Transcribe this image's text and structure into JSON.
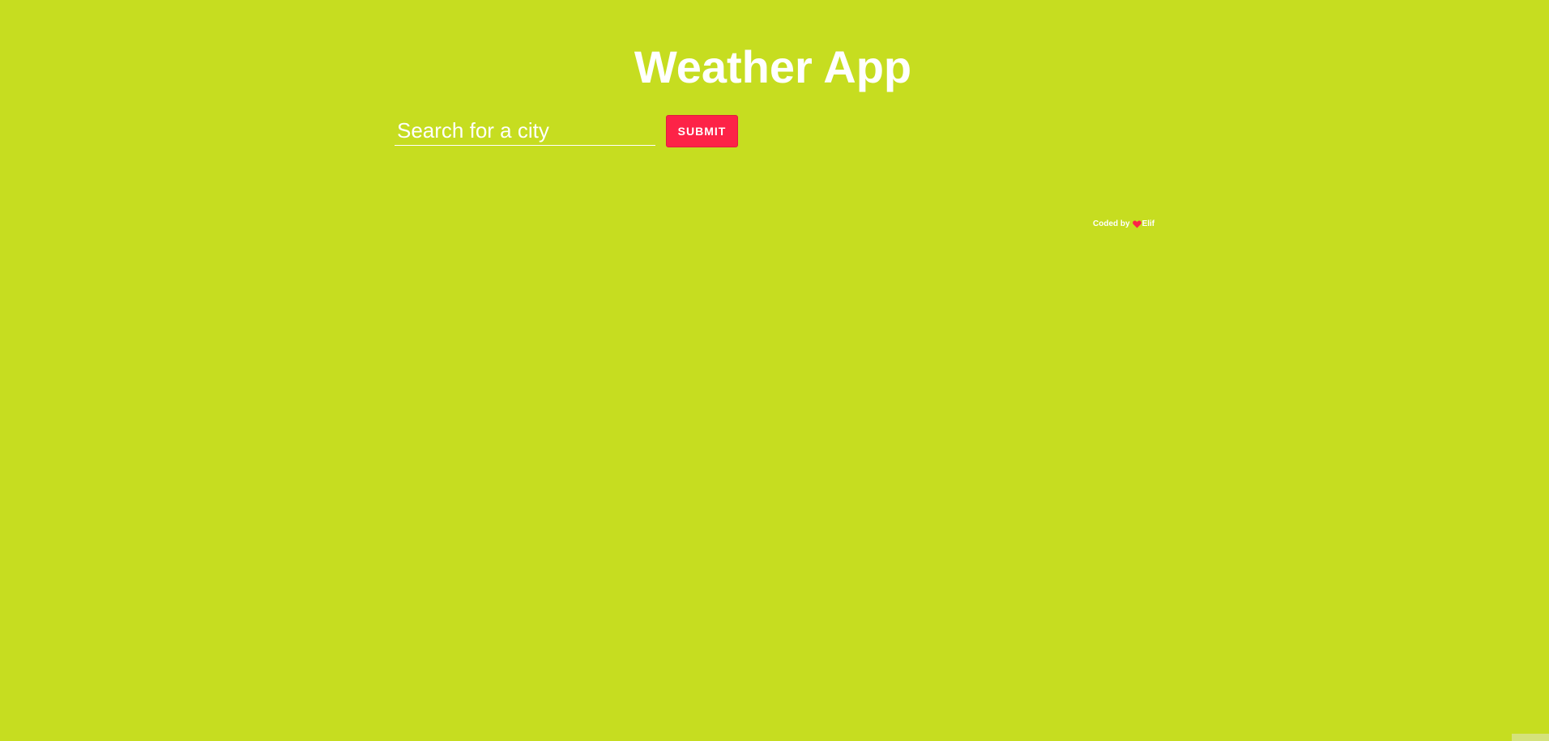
{
  "app": {
    "title": "Weather App"
  },
  "search": {
    "placeholder": "Search for a city",
    "value": "",
    "submit_label": "SUBMIT"
  },
  "footer": {
    "coded_by": "Coded by",
    "author": "Elif",
    "heart_icon": "heart-icon"
  },
  "colors": {
    "background": "#c6dd20",
    "accent": "#fd2347",
    "text": "#ffffff"
  }
}
